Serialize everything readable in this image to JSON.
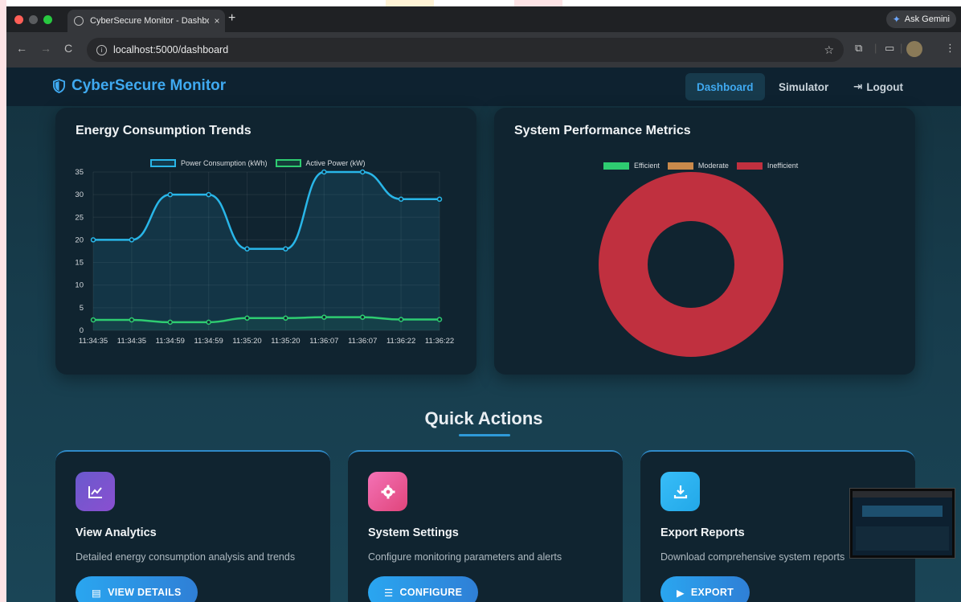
{
  "browser": {
    "tab_title": "CyberSecure Monitor - Dashboard",
    "tab_close": "×",
    "new_tab": "+",
    "gemini_label": "Ask Gemini",
    "url": "localhost:5000/dashboard"
  },
  "nav": {
    "brand": "CyberSecure Monitor",
    "links": [
      "Dashboard",
      "Simulator",
      "Logout"
    ],
    "logout_icon": "logout-icon"
  },
  "energy_card": {
    "title": "Energy Consumption Trends"
  },
  "perf_card": {
    "title": "System Performance Metrics"
  },
  "chart_data": [
    {
      "type": "line",
      "title": "Energy Consumption Trends",
      "x": [
        "11:34:35",
        "11:34:35",
        "11:34:59",
        "11:34:59",
        "11:35:20",
        "11:35:20",
        "11:36:07",
        "11:36:07",
        "11:36:22",
        "11:36:22"
      ],
      "series": [
        {
          "name": "Power Consumption (kWh)",
          "color": "#29b6e8",
          "values": [
            20,
            20,
            30,
            30,
            18,
            18,
            35,
            35,
            29,
            29
          ]
        },
        {
          "name": "Active Power (kW)",
          "color": "#2ecc71",
          "values": [
            2.3,
            2.3,
            1.8,
            1.8,
            2.7,
            2.7,
            2.9,
            2.9,
            2.4,
            2.4
          ]
        }
      ],
      "y_ticks": [
        "0",
        "5",
        "10",
        "15",
        "20",
        "25",
        "30",
        "35"
      ],
      "ylim": [
        0,
        35
      ],
      "grid": true,
      "legend": "top"
    },
    {
      "type": "pie",
      "subtype": "doughnut",
      "title": "System Performance Metrics",
      "labels": [
        "Efficient",
        "Moderate",
        "Inefficient"
      ],
      "colors": [
        "#2ecc71",
        "#c98a4b",
        "#c0303f"
      ],
      "values": [
        0,
        0,
        100
      ],
      "legend": "top"
    }
  ],
  "quick_actions": {
    "title": "Quick Actions",
    "cards": [
      {
        "icon": "chart-line-icon",
        "title": "View Analytics",
        "desc": "Detailed energy consumption analysis and trends",
        "button": "VIEW DETAILS",
        "button_icon": "chart-bars-icon"
      },
      {
        "icon": "gear-icon",
        "title": "System Settings",
        "desc": "Configure monitoring parameters and alerts",
        "button": "CONFIGURE",
        "button_icon": "sliders-icon"
      },
      {
        "icon": "download-icon",
        "title": "Export Reports",
        "desc": "Download comprehensive system reports",
        "button": "EXPORT",
        "button_icon": "file-export-icon"
      }
    ]
  }
}
